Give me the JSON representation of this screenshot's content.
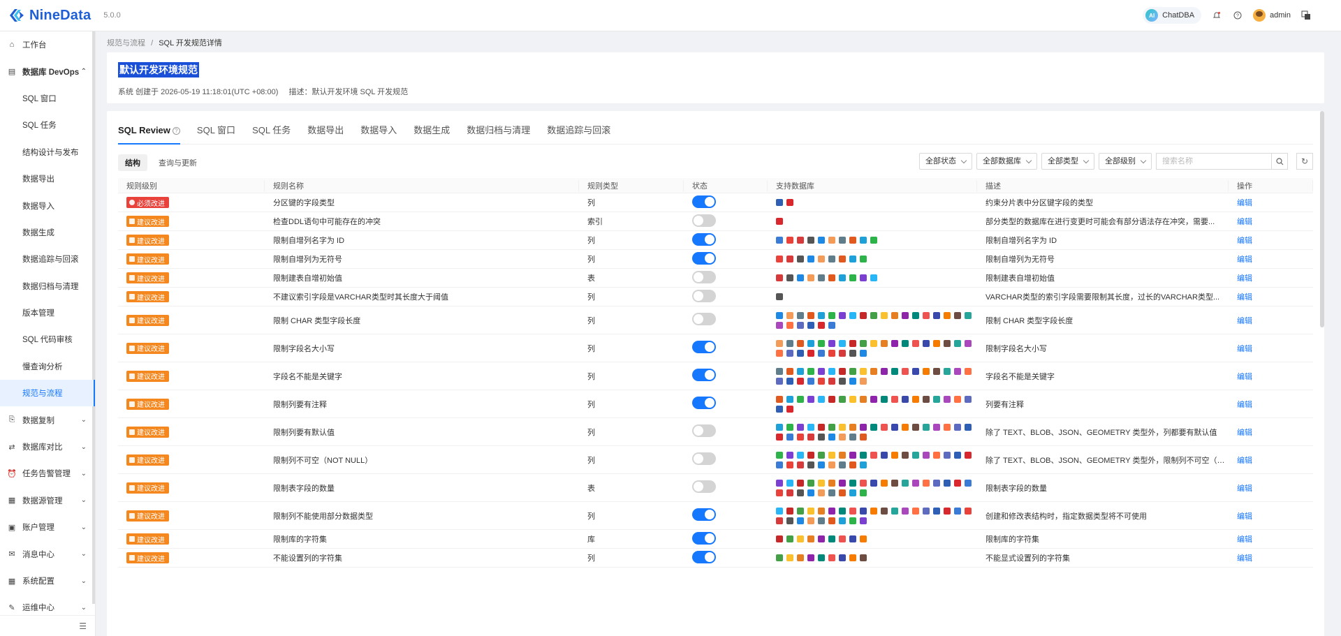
{
  "header": {
    "logo_text": "NineData",
    "version": "5.0.0",
    "chatdba_label": "ChatDBA",
    "chatdba_icon": "AI",
    "user_name": "admin"
  },
  "sidebar": {
    "items": [
      {
        "label": "工作台",
        "icon": "home-icon",
        "level": "top"
      },
      {
        "label": "数据库 DevOps",
        "icon": "devops-icon",
        "level": "group",
        "expanded": true
      },
      {
        "label": "SQL 窗口",
        "level": "sub"
      },
      {
        "label": "SQL 任务",
        "level": "sub"
      },
      {
        "label": "结构设计与发布",
        "level": "sub"
      },
      {
        "label": "数据导出",
        "level": "sub"
      },
      {
        "label": "数据导入",
        "level": "sub"
      },
      {
        "label": "数据生成",
        "level": "sub"
      },
      {
        "label": "数据追踪与回滚",
        "level": "sub"
      },
      {
        "label": "数据归档与清理",
        "level": "sub"
      },
      {
        "label": "版本管理",
        "level": "sub"
      },
      {
        "label": "SQL 代码审核",
        "level": "sub"
      },
      {
        "label": "慢查询分析",
        "level": "sub"
      },
      {
        "label": "规范与流程",
        "level": "sub",
        "active": true
      },
      {
        "label": "数据复制",
        "icon": "copy-icon",
        "level": "top",
        "chevron": true
      },
      {
        "label": "数据库对比",
        "icon": "compare-icon",
        "level": "top",
        "chevron": true
      },
      {
        "label": "任务告警管理",
        "icon": "alarm-icon",
        "level": "top",
        "chevron": true
      },
      {
        "label": "数据源管理",
        "icon": "datasource-icon",
        "level": "top",
        "chevron": true
      },
      {
        "label": "账户管理",
        "icon": "account-icon",
        "level": "top",
        "chevron": true
      },
      {
        "label": "消息中心",
        "icon": "mail-icon",
        "level": "top",
        "chevron": true
      },
      {
        "label": "系统配置",
        "icon": "grid-icon",
        "level": "top",
        "chevron": true
      },
      {
        "label": "运维中心",
        "icon": "tool-icon",
        "level": "top",
        "chevron": true
      }
    ]
  },
  "breadcrumb": {
    "parent": "规范与流程",
    "sep": "/",
    "current": "SQL 开发规范详情"
  },
  "title_card": {
    "title": "默认开发环境规范",
    "meta": "系统 创建于 2026-05-19 11:18:01(UTC +08:00)",
    "desc": "描述：默认开发环境 SQL 开发规范"
  },
  "tabs": [
    "SQL Review",
    "SQL 窗口",
    "SQL 任务",
    "数据导出",
    "数据导入",
    "数据生成",
    "数据归档与清理",
    "数据追踪与回滚"
  ],
  "subtabs": [
    "结构",
    "查询与更新"
  ],
  "filters": {
    "status": "全部状态",
    "database": "全部数据库",
    "type": "全部类型",
    "level": "全部级别",
    "search_placeholder": "搜索名称"
  },
  "table": {
    "headers": [
      "规则级别",
      "规则名称",
      "规则类型",
      "状态",
      "支持数据库",
      "描述",
      "操作"
    ],
    "edit_label": "编辑",
    "rows": [
      {
        "level": "必须改进",
        "level_kind": "must",
        "name": "分区键的字段类型",
        "type": "列",
        "on": true,
        "db_count": 2,
        "desc": "约束分片表中分区键字段的类型"
      },
      {
        "level": "建议改进",
        "level_kind": "warn",
        "name": "检查DDL语句中可能存在的冲突",
        "type": "索引",
        "on": false,
        "db_count": 1,
        "desc": "部分类型的数据库在进行变更时可能会有部分语法存在冲突，需要..."
      },
      {
        "level": "建议改进",
        "level_kind": "warn",
        "name": "限制自增列名字为 ID",
        "type": "列",
        "on": true,
        "db_count": 10,
        "desc": "限制自增列名字为 ID"
      },
      {
        "level": "建议改进",
        "level_kind": "warn",
        "name": "限制自增列为无符号",
        "type": "列",
        "on": true,
        "db_count": 9,
        "desc": "限制自增列为无符号"
      },
      {
        "level": "建议改进",
        "level_kind": "warn",
        "name": "限制建表自增初始值",
        "type": "表",
        "on": false,
        "db_count": 10,
        "desc": "限制建表自增初始值"
      },
      {
        "level": "建议改进",
        "level_kind": "warn",
        "name": "不建议索引字段是VARCHAR类型时其长度大于阈值",
        "type": "列",
        "on": false,
        "db_count": 1,
        "desc": "VARCHAR类型的索引字段需要限制其长度，过长的VARCHAR类型..."
      },
      {
        "level": "建议改进",
        "level_kind": "warn",
        "name": "限制 CHAR 类型字段长度",
        "type": "列",
        "on": false,
        "db_count": 25,
        "desc": "限制 CHAR 类型字段长度"
      },
      {
        "level": "建议改进",
        "level_kind": "warn",
        "name": "限制字段名大小写",
        "type": "列",
        "on": true,
        "db_count": 28,
        "desc": "限制字段名大小写"
      },
      {
        "level": "建议改进",
        "level_kind": "warn",
        "name": "字段名不能是关键字",
        "type": "列",
        "on": true,
        "db_count": 28,
        "desc": "字段名不能是关键字"
      },
      {
        "level": "建议改进",
        "level_kind": "warn",
        "name": "限制列要有注释",
        "type": "列",
        "on": true,
        "db_count": 21,
        "desc": "列要有注释"
      },
      {
        "level": "建议改进",
        "level_kind": "warn",
        "name": "限制列要有默认值",
        "type": "列",
        "on": false,
        "db_count": 28,
        "desc": "除了 TEXT、BLOB、JSON、GEOMETRY 类型外，列都要有默认值"
      },
      {
        "level": "建议改进",
        "level_kind": "warn",
        "name": "限制列不可空（NOT NULL）",
        "type": "列",
        "on": false,
        "db_count": 28,
        "desc": "除了 TEXT、BLOB、JSON、GEOMETRY 类型外，限制列不可空（N..."
      },
      {
        "level": "建议改进",
        "level_kind": "warn",
        "name": "限制表字段的数量",
        "type": "表",
        "on": false,
        "db_count": 28,
        "desc": "限制表字段的数量"
      },
      {
        "level": "建议改进",
        "level_kind": "warn",
        "name": "限制列不能使用部分数据类型",
        "type": "列",
        "on": true,
        "db_count": 28,
        "desc": "创建和修改表结构时，指定数据类型将不可使用"
      },
      {
        "level": "建议改进",
        "level_kind": "warn",
        "name": "限制库的字符集",
        "type": "库",
        "on": true,
        "db_count": 9,
        "desc": "限制库的字符集"
      },
      {
        "level": "建议改进",
        "level_kind": "warn",
        "name": "不能设置列的字符集",
        "type": "列",
        "on": true,
        "db_count": 9,
        "desc": "不能显式设置列的字符集"
      }
    ]
  },
  "db_colors": [
    "#2f5fb4",
    "#d9272e",
    "#3a7bd5",
    "#e8423b",
    "#d63a3a",
    "#555555",
    "#1e88e5",
    "#f39c5a",
    "#607d8b",
    "#e05a1f",
    "#1ea1d9",
    "#2db34a",
    "#7b3fd1",
    "#29b6f6",
    "#c62828",
    "#43a047",
    "#fbc02d",
    "#e67e22",
    "#8e24aa",
    "#00897b",
    "#ef5350",
    "#3949ab",
    "#f57c00",
    "#6d4c41",
    "#26a69a",
    "#ab47bc",
    "#ff7043",
    "#5c6bc0"
  ]
}
